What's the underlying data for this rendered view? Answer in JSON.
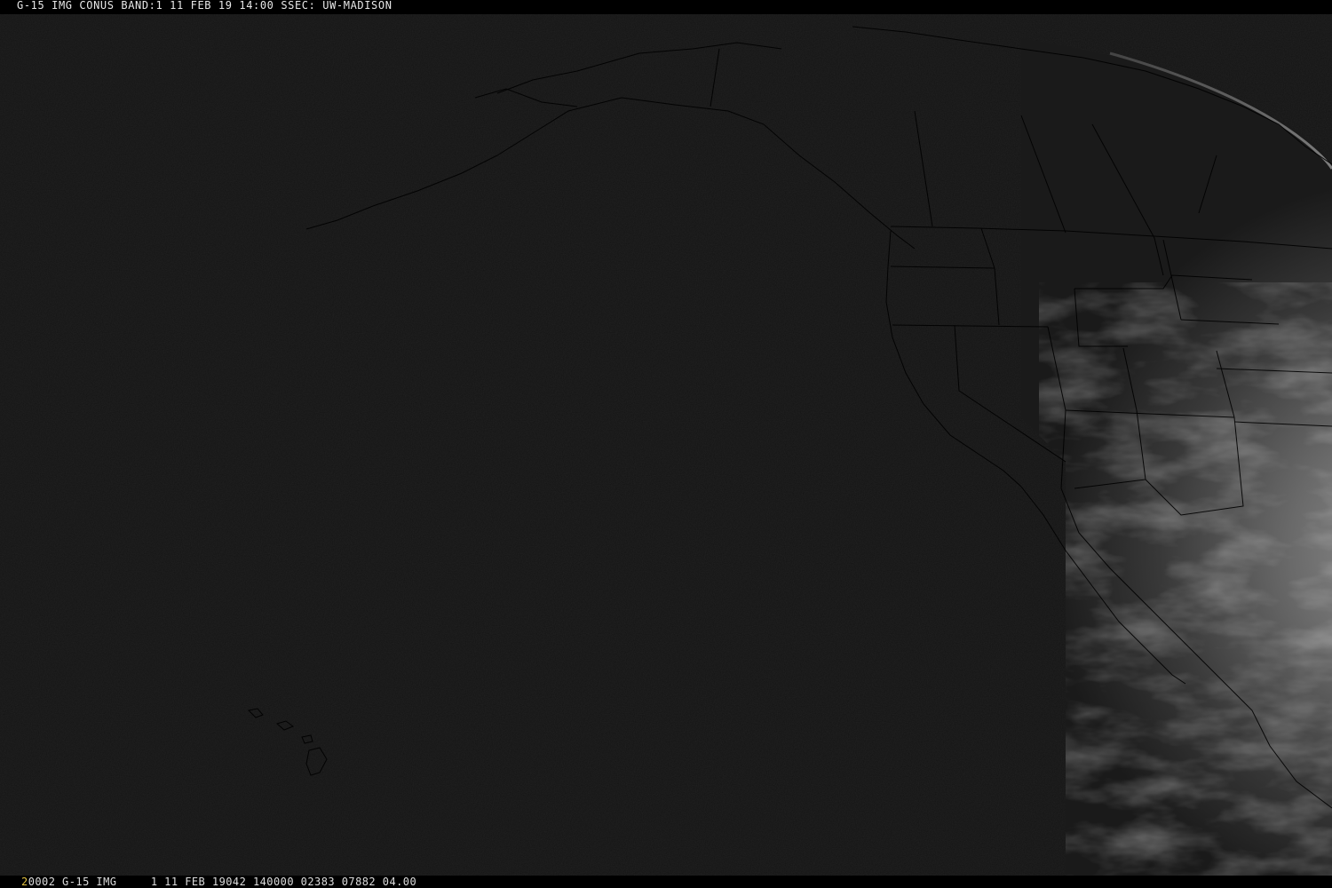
{
  "header": {
    "text": "G-15 IMG CONUS BAND:1 11 FEB 19 14:00 SSEC: UW-MADISON"
  },
  "footer": {
    "frame_number": "2",
    "text": "0002 G-15 IMG     1 11 FEB 19042 140000 02383 07882 04.00"
  },
  "colors": {
    "space": "#141414",
    "border_lines": "#000000",
    "text": "#e8e8e8",
    "frame_number": "#e0c040"
  }
}
